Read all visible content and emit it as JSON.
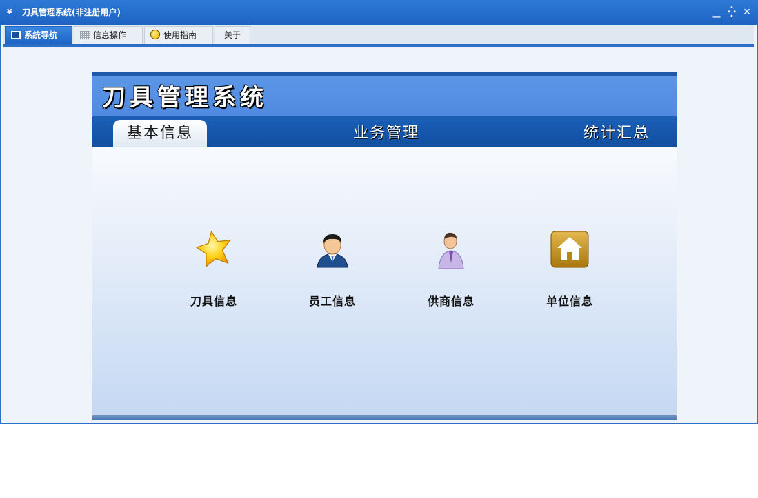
{
  "window": {
    "title": "刀具管理系统(非注册用户)",
    "controls": {
      "minimize": "▁",
      "restore": "⁛",
      "close": "✕"
    }
  },
  "tabs": [
    {
      "label": "系统导航",
      "icon": "nav-icon",
      "active": true
    },
    {
      "label": "信息操作",
      "icon": "grid-icon",
      "active": false
    },
    {
      "label": "使用指南",
      "icon": "guide-icon",
      "active": false
    },
    {
      "label": "关于",
      "icon": "",
      "active": false
    }
  ],
  "panel": {
    "system_title": "刀具管理系统",
    "nav": [
      {
        "label": "基本信息",
        "active": true
      },
      {
        "label": "业务管理",
        "active": false
      },
      {
        "label": "统计汇总",
        "active": false
      }
    ],
    "cards": [
      {
        "label": "刀具信息",
        "icon": "star-icon"
      },
      {
        "label": "员工信息",
        "icon": "employee-icon"
      },
      {
        "label": "供商信息",
        "icon": "supplier-icon"
      },
      {
        "label": "单位信息",
        "icon": "house-icon"
      }
    ]
  },
  "colors": {
    "titlebar": "#2c7ad6",
    "accent": "#2d6fc7",
    "nav_bar": "#1b5fb8",
    "header": "#5b96e6"
  }
}
